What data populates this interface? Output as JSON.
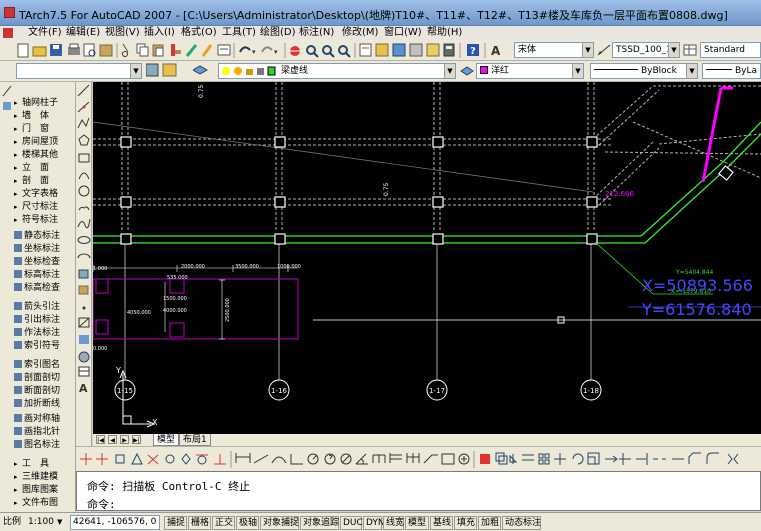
{
  "window": {
    "title": "TArch7.5 For AutoCAD 2007 - [C:\\Users\\Administrator\\Desktop\\(地牌)T10#、T11#、T12#、T13#楼及车库负一层平面布置0808.dwg]"
  },
  "menu": [
    "文件(F)",
    "编辑(E)",
    "视图(V)",
    "插入(I)",
    "格式(O)",
    "工具(T)",
    "绘图(D)",
    "标注(N)",
    "修改(M)",
    "窗口(W)",
    "帮助(H)"
  ],
  "toolbar": {
    "font_combo": "宋体",
    "style_combo": "TSSD_100_100",
    "text_style_combo": "Standard",
    "layer_combo": "梁虚线",
    "color_combo": "洋红",
    "linetype_combo": "ByBlock",
    "lineweight_combo": "ByLa"
  },
  "left_menu": [
    {
      "label": "轴网柱子",
      "kind": "category"
    },
    {
      "label": "墙　体",
      "kind": "category"
    },
    {
      "label": "门　窗",
      "kind": "category"
    },
    {
      "label": "房间屋顶",
      "kind": "category"
    },
    {
      "label": "楼梯其他",
      "kind": "category"
    },
    {
      "label": "立　面",
      "kind": "category"
    },
    {
      "label": "剖　面",
      "kind": "category"
    },
    {
      "label": "文字表格",
      "kind": "category"
    },
    {
      "label": "尺寸标注",
      "kind": "category"
    },
    {
      "label": "符号标注",
      "kind": "category"
    },
    {
      "label": "静态标注",
      "kind": "tool"
    },
    {
      "label": "坐标标注",
      "kind": "tool"
    },
    {
      "label": "坐标检查",
      "kind": "tool"
    },
    {
      "label": "标高标注",
      "kind": "tool"
    },
    {
      "label": "标高检查",
      "kind": "tool"
    },
    {
      "label": "箭头引注",
      "kind": "tool"
    },
    {
      "label": "引出标注",
      "kind": "tool"
    },
    {
      "label": "作法标注",
      "kind": "tool"
    },
    {
      "label": "索引符号",
      "kind": "tool"
    },
    {
      "label": "索引图名",
      "kind": "tool"
    },
    {
      "label": "剖面剖切",
      "kind": "tool"
    },
    {
      "label": "断面剖切",
      "kind": "tool"
    },
    {
      "label": "加折断线",
      "kind": "tool"
    },
    {
      "label": "画对称轴",
      "kind": "tool"
    },
    {
      "label": "画指北针",
      "kind": "tool"
    },
    {
      "label": "图名标注",
      "kind": "tool"
    },
    {
      "label": "工　具",
      "kind": "category"
    },
    {
      "label": "三维建模",
      "kind": "category"
    },
    {
      "label": "图库图案",
      "kind": "category"
    },
    {
      "label": "文件布图",
      "kind": "category"
    }
  ],
  "drawing": {
    "dim_labels": [
      "2000.000",
      "3500.000",
      "1000.000",
      "535.000",
      "4050.000",
      "1500.000",
      "4000.000",
      "2500.000",
      "7.000"
    ],
    "level_label": "212.666",
    "small_dim": "0.75",
    "small_dim2": "0.75",
    "coord_small_x": "X=-1579.810",
    "coord_small_y": "Y=5404.844",
    "coord_x": "X=50893.566",
    "coord_y": "Y=61576.840",
    "axis_labels": [
      "1-15",
      "1-16",
      "1-17",
      "1-18"
    ],
    "ucs_y": "Y",
    "ucs_x": "X",
    "edge_labels": [
      "1.000",
      "0.000"
    ]
  },
  "tabs": {
    "model": "模型",
    "layout1": "布局1"
  },
  "command": {
    "history": "命令: 扫描板 Control-C 终止",
    "prompt": "命令:"
  },
  "status": {
    "scale_label": "比例",
    "scale_value": "1:100",
    "coords": "42641, -106576, 0",
    "toggles": [
      "捕捉",
      "栅格",
      "正交",
      "极轴",
      "对象捕捉",
      "对象追踪",
      "DUCS",
      "DYN",
      "线宽",
      "模型",
      "基线",
      "填充",
      "加粗",
      "动态标注"
    ]
  },
  "colors": {
    "canvas_bg": "#000000",
    "wall": "#33ee33",
    "grid": "#b4b4b4",
    "magenta": "#ff00ff",
    "coord_text": "#4646ff",
    "axis_text": "#ffffff"
  }
}
